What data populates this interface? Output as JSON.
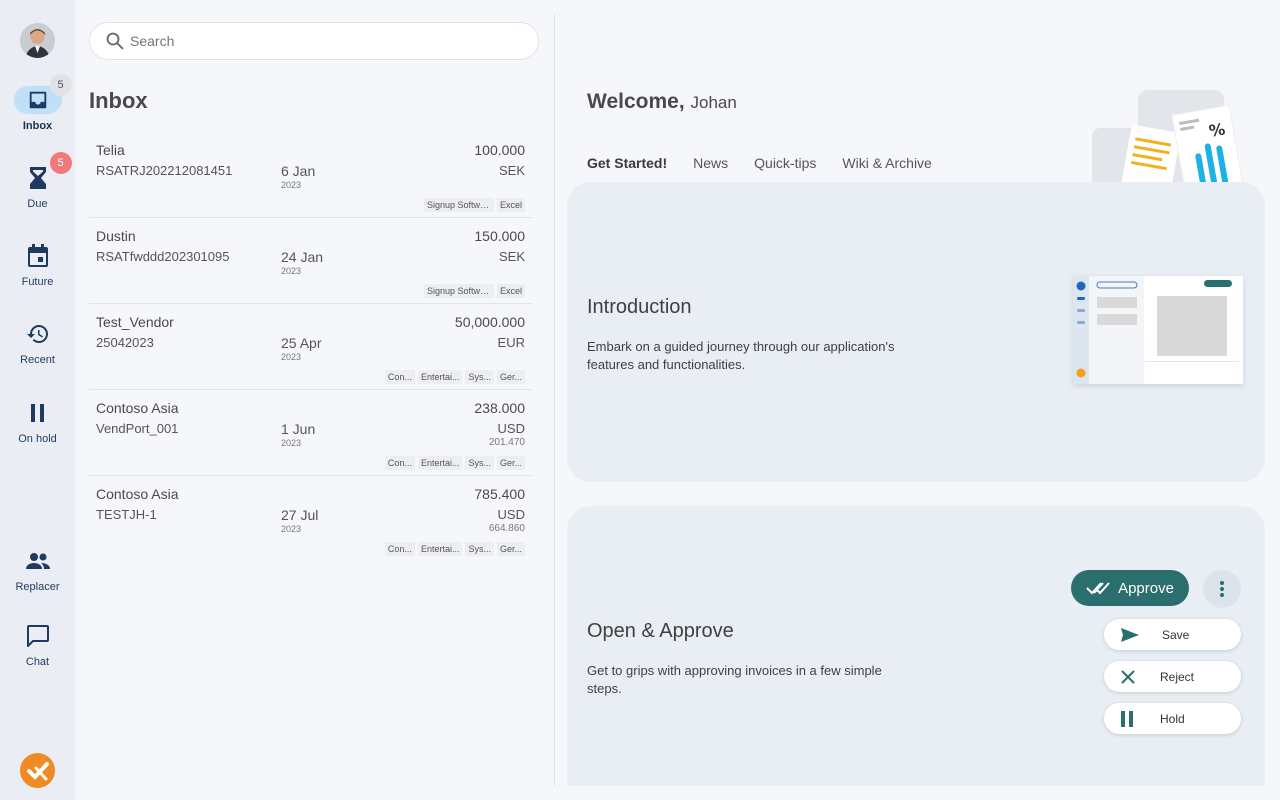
{
  "sidebar": {
    "items": [
      {
        "label": "Inbox",
        "badge": "5"
      },
      {
        "label": "Due",
        "badge": "5"
      },
      {
        "label": "Future"
      },
      {
        "label": "Recent"
      },
      {
        "label": "On hold"
      },
      {
        "label": "Replacer"
      },
      {
        "label": "Chat"
      }
    ]
  },
  "search": {
    "placeholder": "Search"
  },
  "inbox": {
    "title": "Inbox",
    "rows": [
      {
        "vendor": "Telia",
        "ref": "RSATRJ202212081451",
        "date": "6 Jan",
        "year": "2023",
        "amount": "100.000",
        "currency": "SEK",
        "sub_amount": "",
        "tags": [
          "Signup Software AB",
          "Excel"
        ]
      },
      {
        "vendor": "Dustin",
        "ref": "RSATfwddd202301095",
        "date": "24 Jan",
        "year": "2023",
        "amount": "150.000",
        "currency": "SEK",
        "sub_amount": "",
        "tags": [
          "Signup Software AB",
          "Excel"
        ]
      },
      {
        "vendor": "Test_Vendor",
        "ref": "25042023",
        "date": "25 Apr",
        "year": "2023",
        "amount": "50,000.000",
        "currency": "EUR",
        "sub_amount": "",
        "tags": [
          "Con...",
          "Entertai...",
          "Sys...",
          "Ger..."
        ]
      },
      {
        "vendor": "Contoso Asia",
        "ref": "VendPort_001",
        "date": "1 Jun",
        "year": "2023",
        "amount": "238.000",
        "currency": "USD",
        "sub_amount": "201.470",
        "tags": [
          "Con...",
          "Entertai...",
          "Sys...",
          "Ger..."
        ]
      },
      {
        "vendor": "Contoso Asia",
        "ref": "TESTJH-1",
        "date": "27 Jul",
        "year": "2023",
        "amount": "785.400",
        "currency": "USD",
        "sub_amount": "664.860",
        "tags": [
          "Con...",
          "Entertai...",
          "Sys...",
          "Ger..."
        ]
      }
    ]
  },
  "main": {
    "welcome": "Welcome,",
    "user_name": "Johan",
    "tabs": [
      "Get Started!",
      "News",
      "Quick-tips",
      "Wiki & Archive"
    ],
    "cards": [
      {
        "title": "Introduction",
        "desc": "Embark on a guided journey through our application's features and functionalities."
      },
      {
        "title": "Open & Approve",
        "desc": "Get to grips with approving invoices in a few simple steps."
      }
    ],
    "actions": {
      "approve": "Approve",
      "save": "Save",
      "reject": "Reject",
      "hold": "Hold"
    }
  },
  "colors": {
    "accent": "#2b6e6e",
    "nav_active": "#bfe0f7",
    "badge_red": "#f07a7a",
    "logo": "#f08a24"
  }
}
